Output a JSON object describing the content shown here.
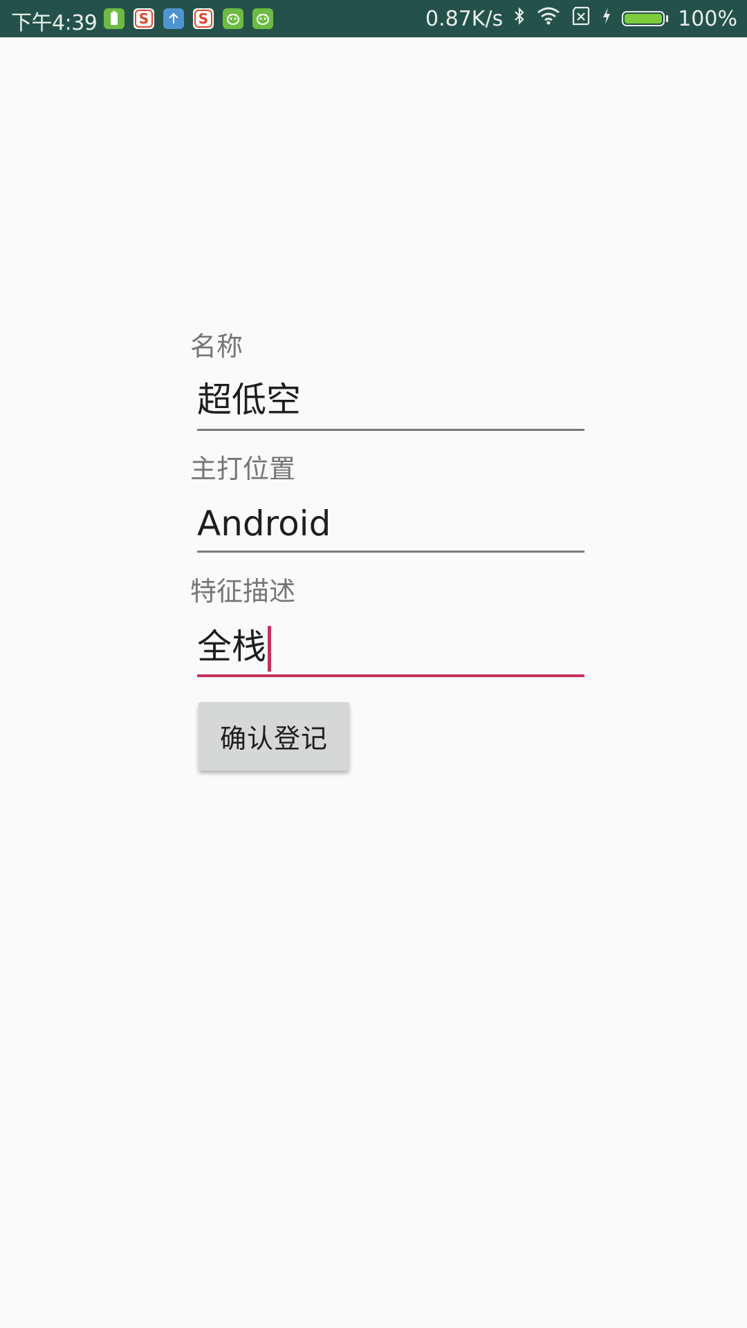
{
  "status_bar": {
    "time": "下午4:39",
    "net_speed": "0.87K/s",
    "battery": "100%",
    "notification_icons": [
      "battery-app-icon",
      "sogou-icon",
      "upload-icon",
      "sogou-icon",
      "android-bug-icon",
      "android-bug-icon"
    ]
  },
  "form": {
    "fields": [
      {
        "label": "名称",
        "value": "超低空"
      },
      {
        "label": "主打位置",
        "value": "Android"
      },
      {
        "label": "特征描述",
        "value": "全栈"
      }
    ],
    "submit_label": "确认登记"
  },
  "colors": {
    "status_bar_bg": "#24524a",
    "background": "#fafafa",
    "accent": "#c4325b",
    "button_bg": "#d6d7d7"
  }
}
